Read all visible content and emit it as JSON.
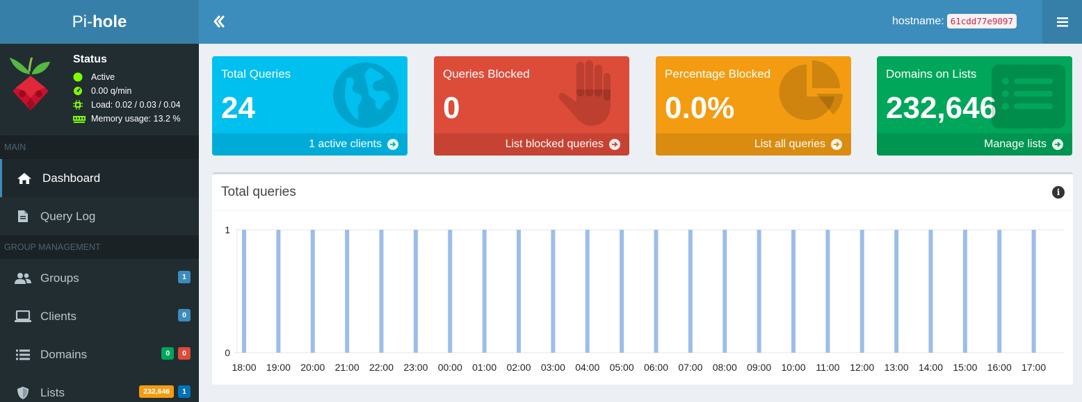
{
  "header": {
    "brand_prefix": "Pi-",
    "brand_bold": "hole",
    "hostname_label": "hostname:",
    "hostname_value": "61cdd77e9097"
  },
  "status": {
    "title": "Status",
    "active": "Active",
    "qpm": "0.00 q/min",
    "load": "Load: 0.02 / 0.03 / 0.04",
    "memory": "Memory usage: 13.2 %"
  },
  "sidebar": {
    "main_header": "MAIN",
    "group_header": "GROUP MANAGEMENT",
    "items": [
      {
        "label": "Dashboard",
        "icon": "home-icon"
      },
      {
        "label": "Query Log",
        "icon": "file-icon"
      },
      {
        "label": "Groups",
        "icon": "users-icon",
        "badges": [
          "1"
        ]
      },
      {
        "label": "Clients",
        "icon": "laptop-icon",
        "badges": [
          "0"
        ]
      },
      {
        "label": "Domains",
        "icon": "list-icon",
        "badges": [
          "0",
          "0"
        ]
      },
      {
        "label": "Lists",
        "icon": "shield-icon",
        "badges": [
          "232,646",
          "1"
        ]
      }
    ]
  },
  "boxes": [
    {
      "label": "Total Queries",
      "value": "24",
      "footer": "1 active clients",
      "color": "#00c0ef",
      "footer_color": "#00acd7",
      "icon": "globe-icon"
    },
    {
      "label": "Queries Blocked",
      "value": "0",
      "footer": "List blocked queries",
      "color": "#dd4b39",
      "footer_color": "#c64333",
      "icon": "hand-icon"
    },
    {
      "label": "Percentage Blocked",
      "value": "0.0%",
      "footer": "List all queries",
      "color": "#f39c12",
      "footer_color": "#da8c10",
      "icon": "pie-chart-icon"
    },
    {
      "label": "Domains on Lists",
      "value": "232,646",
      "footer": "Manage lists",
      "color": "#00a65a",
      "footer_color": "#009551",
      "icon": "list-alt-icon"
    }
  ],
  "chart_panel": {
    "title": "Total queries",
    "info": "i"
  },
  "chart_data": {
    "type": "bar",
    "categories": [
      "18:00",
      "19:00",
      "20:00",
      "21:00",
      "22:00",
      "23:00",
      "00:00",
      "01:00",
      "02:00",
      "03:00",
      "04:00",
      "05:00",
      "06:00",
      "07:00",
      "08:00",
      "09:00",
      "10:00",
      "11:00",
      "12:00",
      "13:00",
      "14:00",
      "15:00",
      "16:00",
      "17:00"
    ],
    "values": [
      1,
      1,
      1,
      1,
      1,
      1,
      1,
      1,
      1,
      1,
      1,
      1,
      1,
      1,
      1,
      1,
      1,
      1,
      1,
      1,
      1,
      1,
      1,
      1
    ],
    "ylim": [
      0,
      1
    ],
    "yticks": [
      "0",
      "1"
    ],
    "bar_color": "#9cbdea",
    "grid": true
  }
}
